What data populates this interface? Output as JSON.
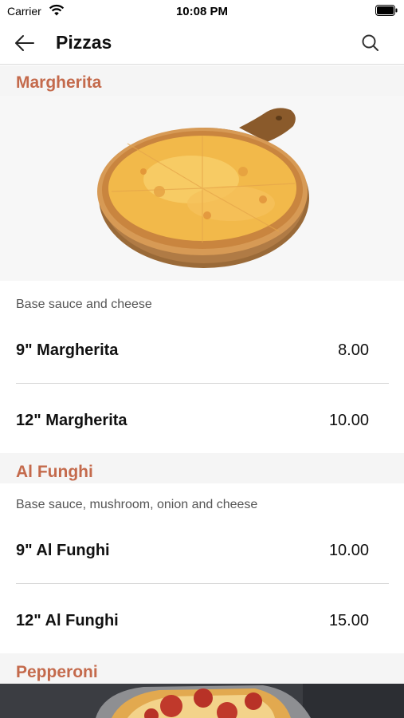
{
  "status_bar": {
    "carrier": "Carrier",
    "time": "10:08 PM"
  },
  "header": {
    "title": "Pizzas",
    "back_icon": "arrow-left-icon",
    "search_icon": "search-icon"
  },
  "sections": [
    {
      "title": "Margherita",
      "description": "Base sauce and cheese",
      "items": [
        {
          "name": "9\" Margherita",
          "price": "8.00"
        },
        {
          "name": "12\" Margherita",
          "price": "10.00"
        }
      ]
    },
    {
      "title": "Al Funghi",
      "description": "Base sauce, mushroom, onion and cheese",
      "items": [
        {
          "name": "9\" Al Funghi",
          "price": "10.00"
        },
        {
          "name": "12\" Al Funghi",
          "price": "15.00"
        }
      ]
    },
    {
      "title": "Pepperoni"
    }
  ],
  "colors": {
    "accent": "#c46a4c",
    "section_bg": "#f5f5f5",
    "divider": "#d6d6d6"
  }
}
